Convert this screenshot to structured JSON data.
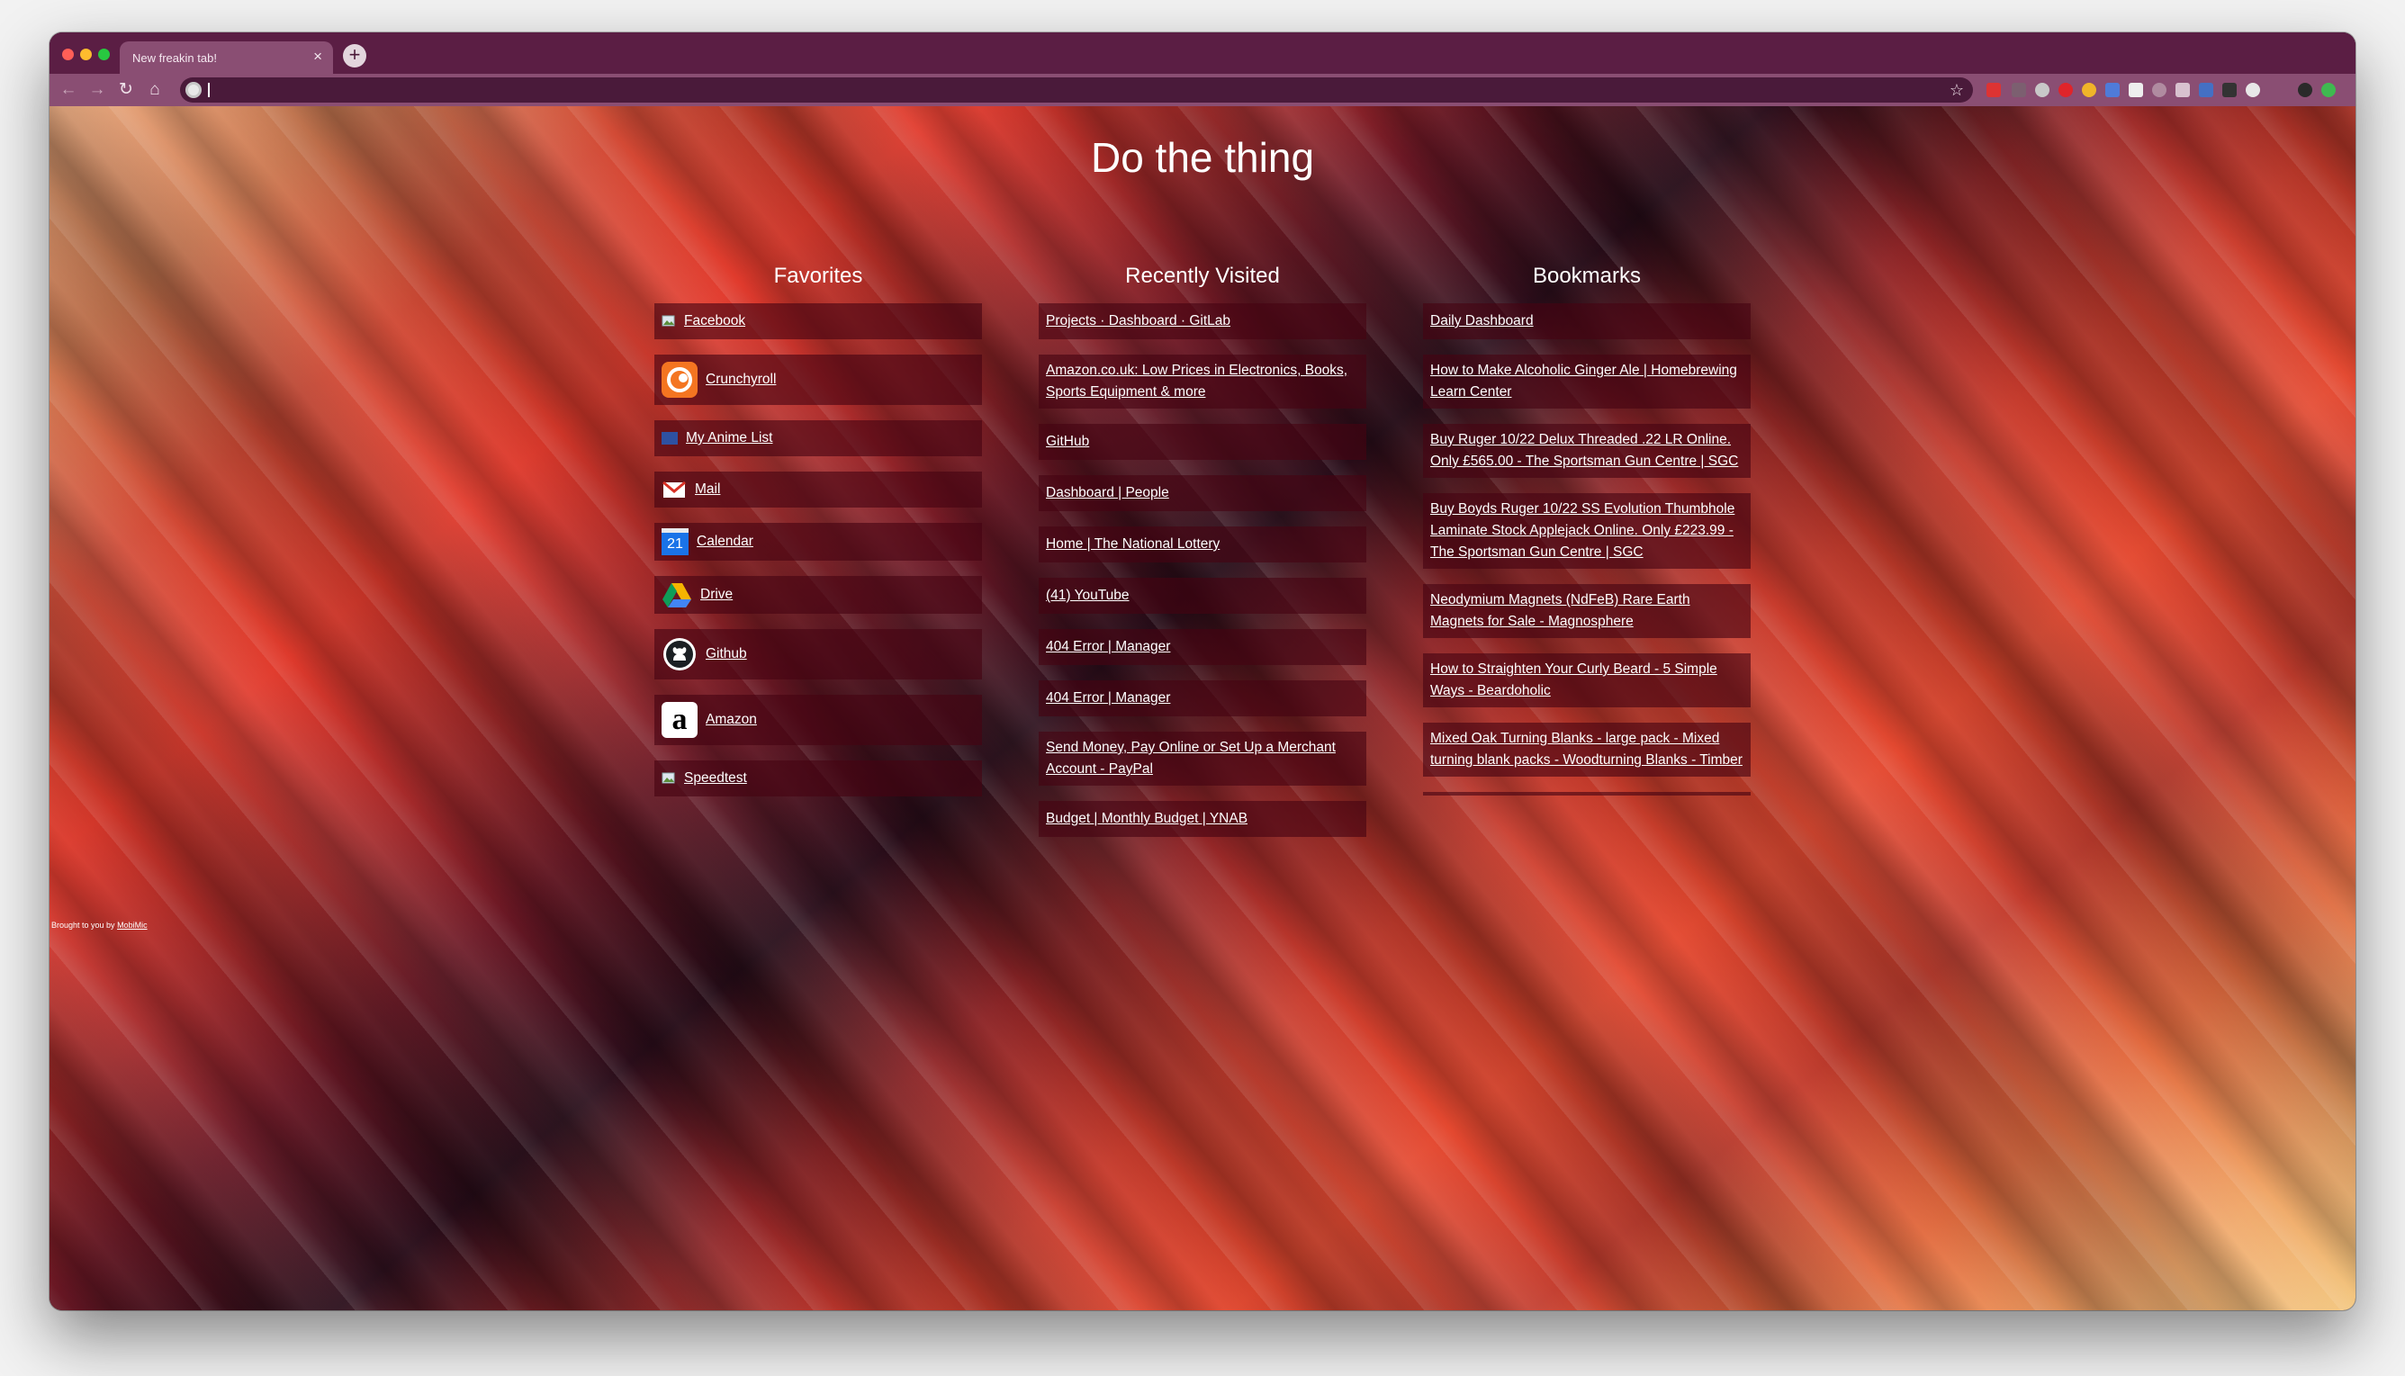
{
  "browser": {
    "tab_title": "New freakin tab!",
    "tab_close": "×",
    "new_tab": "+",
    "omnibox_value": ""
  },
  "nav": {
    "back_icon": "←",
    "forward_icon": "→",
    "reload_icon": "↻",
    "home_icon": "⌂",
    "star_icon": "☆"
  },
  "page": {
    "title": "Do the thing",
    "footer_text": "Brought to you by",
    "footer_link": "MobiMic"
  },
  "favorites": {
    "title": "Favorites",
    "items": [
      {
        "label": "Facebook",
        "icon": "broken-image-icon"
      },
      {
        "label": "Crunchyroll",
        "icon": "crunchyroll-icon"
      },
      {
        "label": "My Anime List",
        "icon": "myanimelist-icon"
      },
      {
        "label": "Mail",
        "icon": "gmail-icon"
      },
      {
        "label": "Calendar",
        "icon": "calendar-icon",
        "glyph": "21"
      },
      {
        "label": "Drive",
        "icon": "drive-icon"
      },
      {
        "label": "Github",
        "icon": "github-icon"
      },
      {
        "label": "Amazon",
        "icon": "amazon-icon",
        "glyph": "a"
      },
      {
        "label": "Speedtest",
        "icon": "broken-image-icon"
      }
    ]
  },
  "recent": {
    "title": "Recently Visited",
    "items": [
      "Projects · Dashboard · GitLab",
      "Amazon.co.uk: Low Prices in Electronics, Books, Sports Equipment & more",
      "GitHub",
      "Dashboard | People",
      "Home | The National Lottery",
      "(41) YouTube",
      "404 Error | Manager",
      "404 Error | Manager",
      "Send Money, Pay Online or Set Up a Merchant Account - PayPal",
      "Budget | Monthly Budget | YNAB"
    ]
  },
  "bookmarks": {
    "title": "Bookmarks",
    "items": [
      "Daily Dashboard",
      "How to Make Alcoholic Ginger Ale | Homebrewing Learn Center",
      "Buy Ruger 10/22 Delux Threaded .22 LR Online. Only £565.00 - The Sportsman Gun Centre | SGC",
      "Buy Boyds Ruger 10/22 SS Evolution Thumbhole Laminate Stock Applejack Online. Only £223.99 - The Sportsman Gun Centre | SGC",
      "Neodymium Magnets (NdFeB) Rare Earth Magnets for Sale - Magnosphere",
      "How to Straighten Your Curly Beard - 5 Simple Ways - Beardoholic",
      "Mixed Oak Turning Blanks - large pack - Mixed turning blank packs - Woodturning Blanks - Timber"
    ]
  },
  "colors": {
    "tabstrip": "#5b1e44",
    "toolbar": "#8a4e73",
    "card_bg": "rgba(70,4,18,0.62)"
  }
}
